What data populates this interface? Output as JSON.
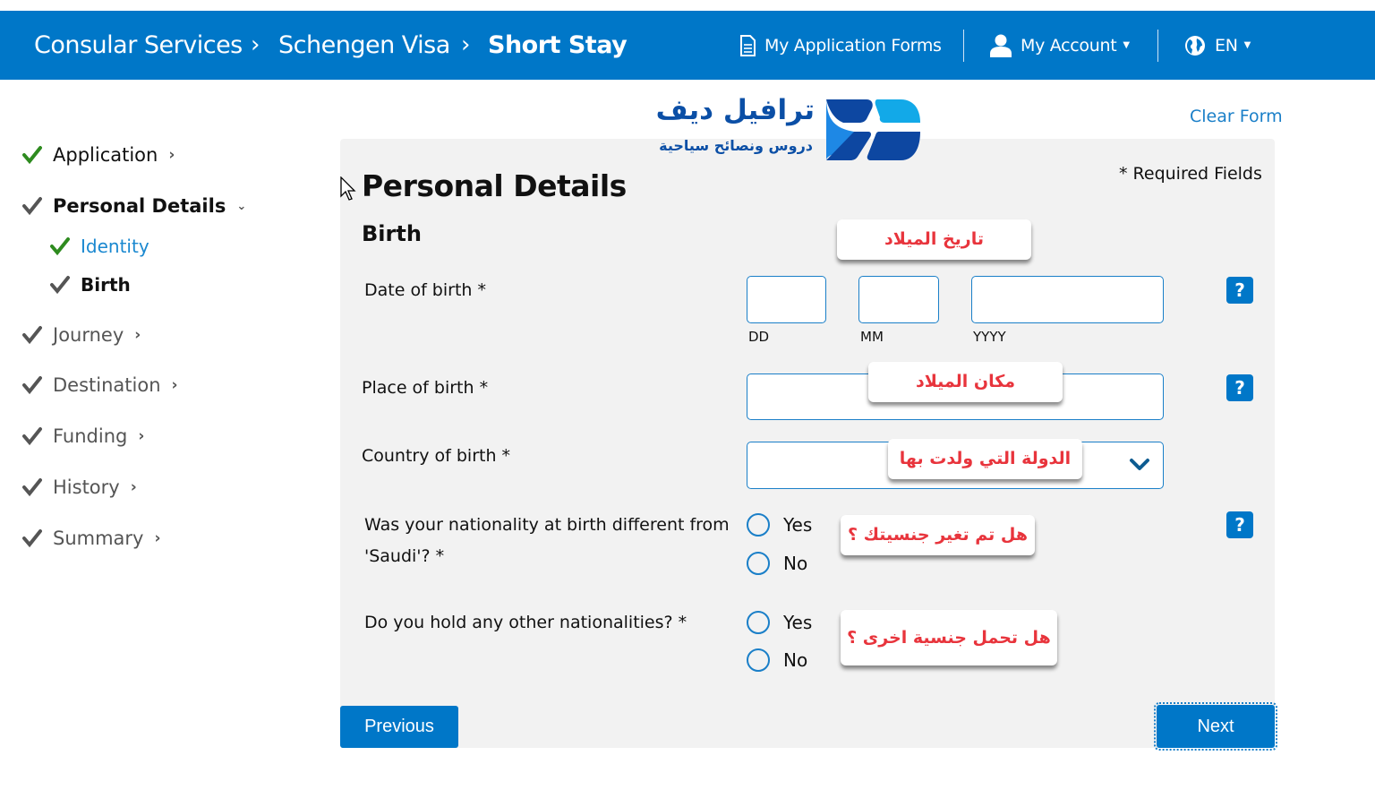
{
  "header": {
    "breadcrumb": [
      "Consular Services",
      "Schengen Visa",
      "Short Stay"
    ],
    "breadcrumb_separator": ">",
    "nav": {
      "application_forms": "My Application Forms",
      "account": "My Account",
      "language": "EN"
    },
    "icons": {
      "application_forms": "document-icon",
      "account": "user-icon",
      "language": "globe-icon"
    }
  },
  "branding": {
    "logo_title": "ترافيل ديف",
    "logo_subtitle": "دروس ونصائح سياحية"
  },
  "sidebar": {
    "items": [
      {
        "label": "Application",
        "status": "complete",
        "expander": "chevron-right"
      },
      {
        "label": "Personal Details",
        "status": "current",
        "expander": "chevron-down",
        "active": true
      },
      {
        "label": "Identity",
        "status": "complete",
        "sub": true,
        "link": true
      },
      {
        "label": "Birth",
        "status": "current",
        "sub": true,
        "active": true
      },
      {
        "label": "Journey",
        "status": "pending",
        "expander": "chevron-right"
      },
      {
        "label": "Destination",
        "status": "pending",
        "expander": "chevron-right"
      },
      {
        "label": "Funding",
        "status": "pending",
        "expander": "chevron-right"
      },
      {
        "label": "History",
        "status": "pending",
        "expander": "chevron-right"
      },
      {
        "label": "Summary",
        "status": "pending",
        "expander": "chevron-right"
      }
    ]
  },
  "form": {
    "clear_form": "Clear Form",
    "required_note": "* Required Fields",
    "title": "Personal Details",
    "section": "Birth",
    "fields": {
      "date_of_birth": {
        "label": "Date of birth *",
        "day_label": "DD",
        "month_label": "MM",
        "year_label": "YYYY",
        "day_value": "",
        "month_value": "",
        "year_value": ""
      },
      "place_of_birth": {
        "label": "Place of birth *",
        "value": ""
      },
      "country_of_birth": {
        "label": "Country of birth *",
        "value": ""
      },
      "nationality_different": {
        "label_line1": "Was your nationality at birth different from",
        "label_line2": "'Saudi'? *",
        "options": [
          "Yes",
          "No"
        ],
        "selected": null
      },
      "other_nationalities": {
        "label": "Do you hold any other nationalities? *",
        "options": [
          "Yes",
          "No"
        ],
        "selected": null
      }
    },
    "help_icon": "?",
    "previous": "Previous",
    "next": "Next"
  },
  "annotations": {
    "date_of_birth": "تاريخ الميلاد",
    "place_of_birth": "مكان الميلاد",
    "country_of_birth": "الدولة التي ولدت بها",
    "nationality_changed": "هل تم تغير جنسيتك ؟",
    "other_nationality": "هل تحمل جنسية اخرى ؟"
  },
  "colors": {
    "brand_blue": "#0077c8",
    "link_blue": "#1a7fc8",
    "check_green": "#2e8b1f",
    "panel_bg": "#f2f2f2",
    "annotation_red": "#e8343c"
  }
}
